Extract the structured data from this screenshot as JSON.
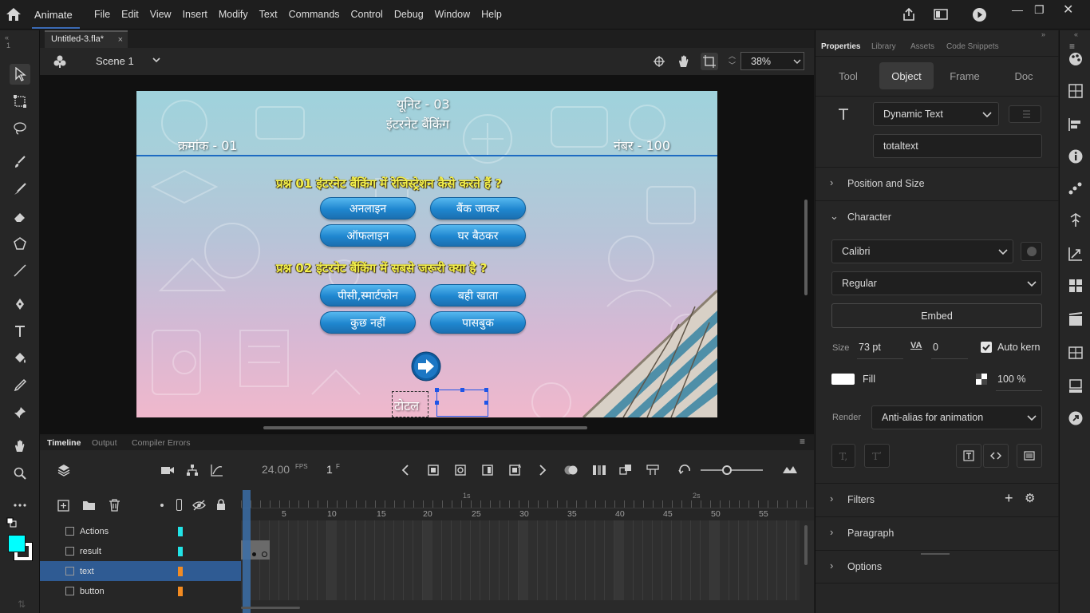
{
  "app": {
    "name": "Animate"
  },
  "menu": [
    "File",
    "Edit",
    "View",
    "Insert",
    "Modify",
    "Text",
    "Commands",
    "Control",
    "Debug",
    "Window",
    "Help"
  ],
  "document": {
    "tab": "Untitled-3.fla*",
    "scene": "Scene 1",
    "zoom": "38%"
  },
  "stage": {
    "unit": "यूनिट - 03",
    "subject": "इंटरनेट बैंकिंग",
    "serial": "क्रमांक - 01",
    "marks": "नंबर - 100",
    "q1": "प्रश्न 01  इंटरनेट बैंकिंग में रेजिस्ट्रेशन कैसे करते हैं ?",
    "q1_options": [
      "अनलाइन",
      "बैंक जाकर",
      "ऑफलाइन",
      "घर बैठकर"
    ],
    "q2": "प्रश्न 02  इंटरनेट बैंकिंग में सबसे जरूरी क्या है ?",
    "q2_options": [
      "पीसी,स्मार्टफोन",
      "बही खाता",
      "कुछ नहीं",
      "पासबुक"
    ],
    "total_label": "टोटल"
  },
  "timeline": {
    "tabs": [
      "Timeline",
      "Output",
      "Compiler Errors"
    ],
    "fps": "24.00",
    "fps_unit": "FPS",
    "frame": "1",
    "frame_unit": "F",
    "ruler": [
      "5",
      "10",
      "15",
      "20",
      "25",
      "30",
      "35",
      "40",
      "45",
      "50",
      "55"
    ],
    "seconds": [
      "1s",
      "2s"
    ],
    "layers": [
      {
        "name": "Actions",
        "color": "#22e3e6",
        "selected": false
      },
      {
        "name": "result",
        "color": "#22e3e6",
        "selected": false
      },
      {
        "name": "text",
        "color": "#f28b22",
        "selected": true
      },
      {
        "name": "button",
        "color": "#f28b22",
        "selected": false
      }
    ]
  },
  "properties": {
    "tabs": [
      "Properties",
      "Library",
      "Assets",
      "Code Snippets"
    ],
    "segments": [
      "Tool",
      "Object",
      "Frame",
      "Doc"
    ],
    "text_type": "Dynamic Text",
    "instance_name": "totaltext",
    "sections": {
      "position": "Position and Size",
      "character": "Character",
      "filters": "Filters",
      "paragraph": "Paragraph",
      "options": "Options"
    },
    "font": "Calibri",
    "style": "Regular",
    "embed": "Embed",
    "size_label": "Size",
    "size": "73 pt",
    "tracking": "0",
    "autokern": "Auto kern",
    "fill_label": "Fill",
    "fill_alpha": "100 %",
    "render_label": "Render",
    "render": "Anti-alias for animation",
    "fill_color": "#ffffff"
  },
  "colors": {
    "stroke": "#000000",
    "fill": "#00ffff",
    "accent": "#3b6ea8"
  }
}
